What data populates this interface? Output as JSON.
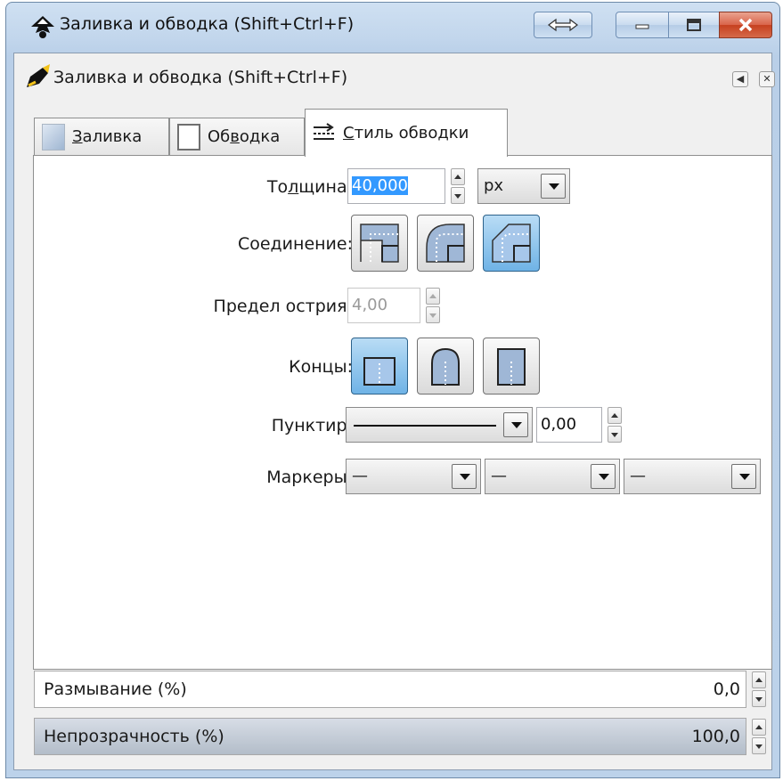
{
  "window": {
    "title": "Заливка и обводка (Shift+Ctrl+F)",
    "accent": "#c2d6ec",
    "close_color": "#d9644a"
  },
  "dock": {
    "title": "Заливка и обводка (Shift+Ctrl+F)"
  },
  "tabs": [
    {
      "pre": "",
      "accel": "З",
      "post": "аливка",
      "icon": "fill-swatch-icon"
    },
    {
      "pre": "Об",
      "accel": "в",
      "post": "одка",
      "icon": "stroke-swatch-icon"
    },
    {
      "pre": "",
      "accel": "С",
      "post": "тиль обводки",
      "icon": "stroke-style-icon",
      "active": true
    }
  ],
  "stroke_style": {
    "width_label_pre": "То",
    "width_label_accel": "л",
    "width_label_post": "щина:",
    "width_value": "40,000",
    "unit": "px",
    "join_label": "Соединение:",
    "join_options": [
      "miter-join",
      "round-join",
      "bevel-join"
    ],
    "join_selected": "bevel-join",
    "miter_label_pre": "Пре",
    "miter_label_accel": "д",
    "miter_label_post": "ел острия:",
    "miter_value": "4,00",
    "cap_label": "Концы:",
    "cap_options": [
      "butt-cap",
      "round-cap",
      "square-cap"
    ],
    "cap_selected": "butt-cap",
    "dash_label": "Пунктир:",
    "dash_offset": "0,00",
    "markers_label": "Маркеры:",
    "markers": [
      "—",
      "—",
      "—"
    ]
  },
  "blur": {
    "label": "Размывание (%)",
    "value": "0,0",
    "fraction": 0.0
  },
  "opacity": {
    "label": "Непрозрачность (%)",
    "value": "100,0",
    "fraction": 1.0
  }
}
